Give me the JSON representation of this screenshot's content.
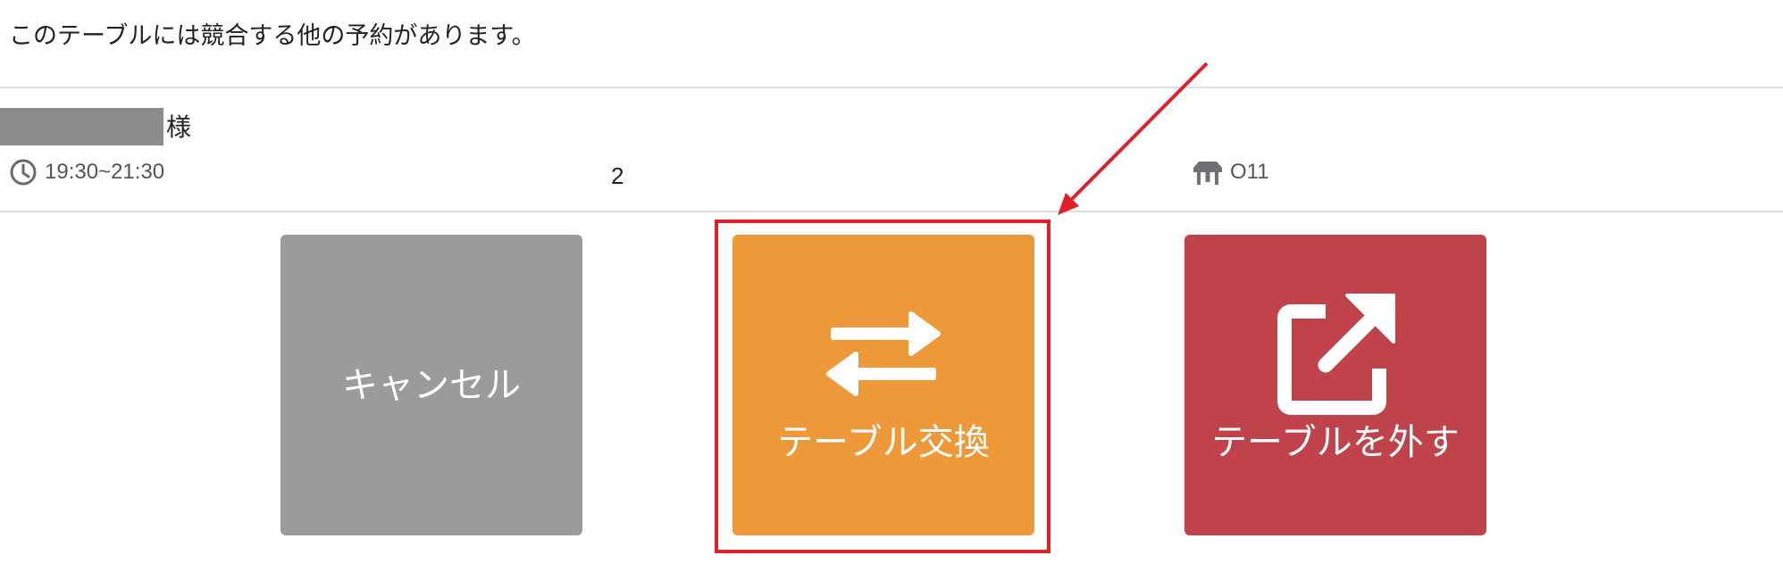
{
  "message": "このテーブルには競合する他の予約があります。",
  "reservation": {
    "honorific": "様",
    "time": "19:30~21:30",
    "party_size": "2",
    "table": "O11"
  },
  "actions": {
    "cancel": "キャンセル",
    "swap": "テーブル交換",
    "remove": "テーブルを外す"
  },
  "icons": {
    "clock": "clock-icon",
    "table": "table-icon",
    "swap": "swap-arrows-icon",
    "remove": "external-link-icon"
  },
  "colors": {
    "cancel": "#9b9b9b",
    "swap": "#ee9939",
    "remove": "#c0424a",
    "annotation": "#e0202a"
  }
}
